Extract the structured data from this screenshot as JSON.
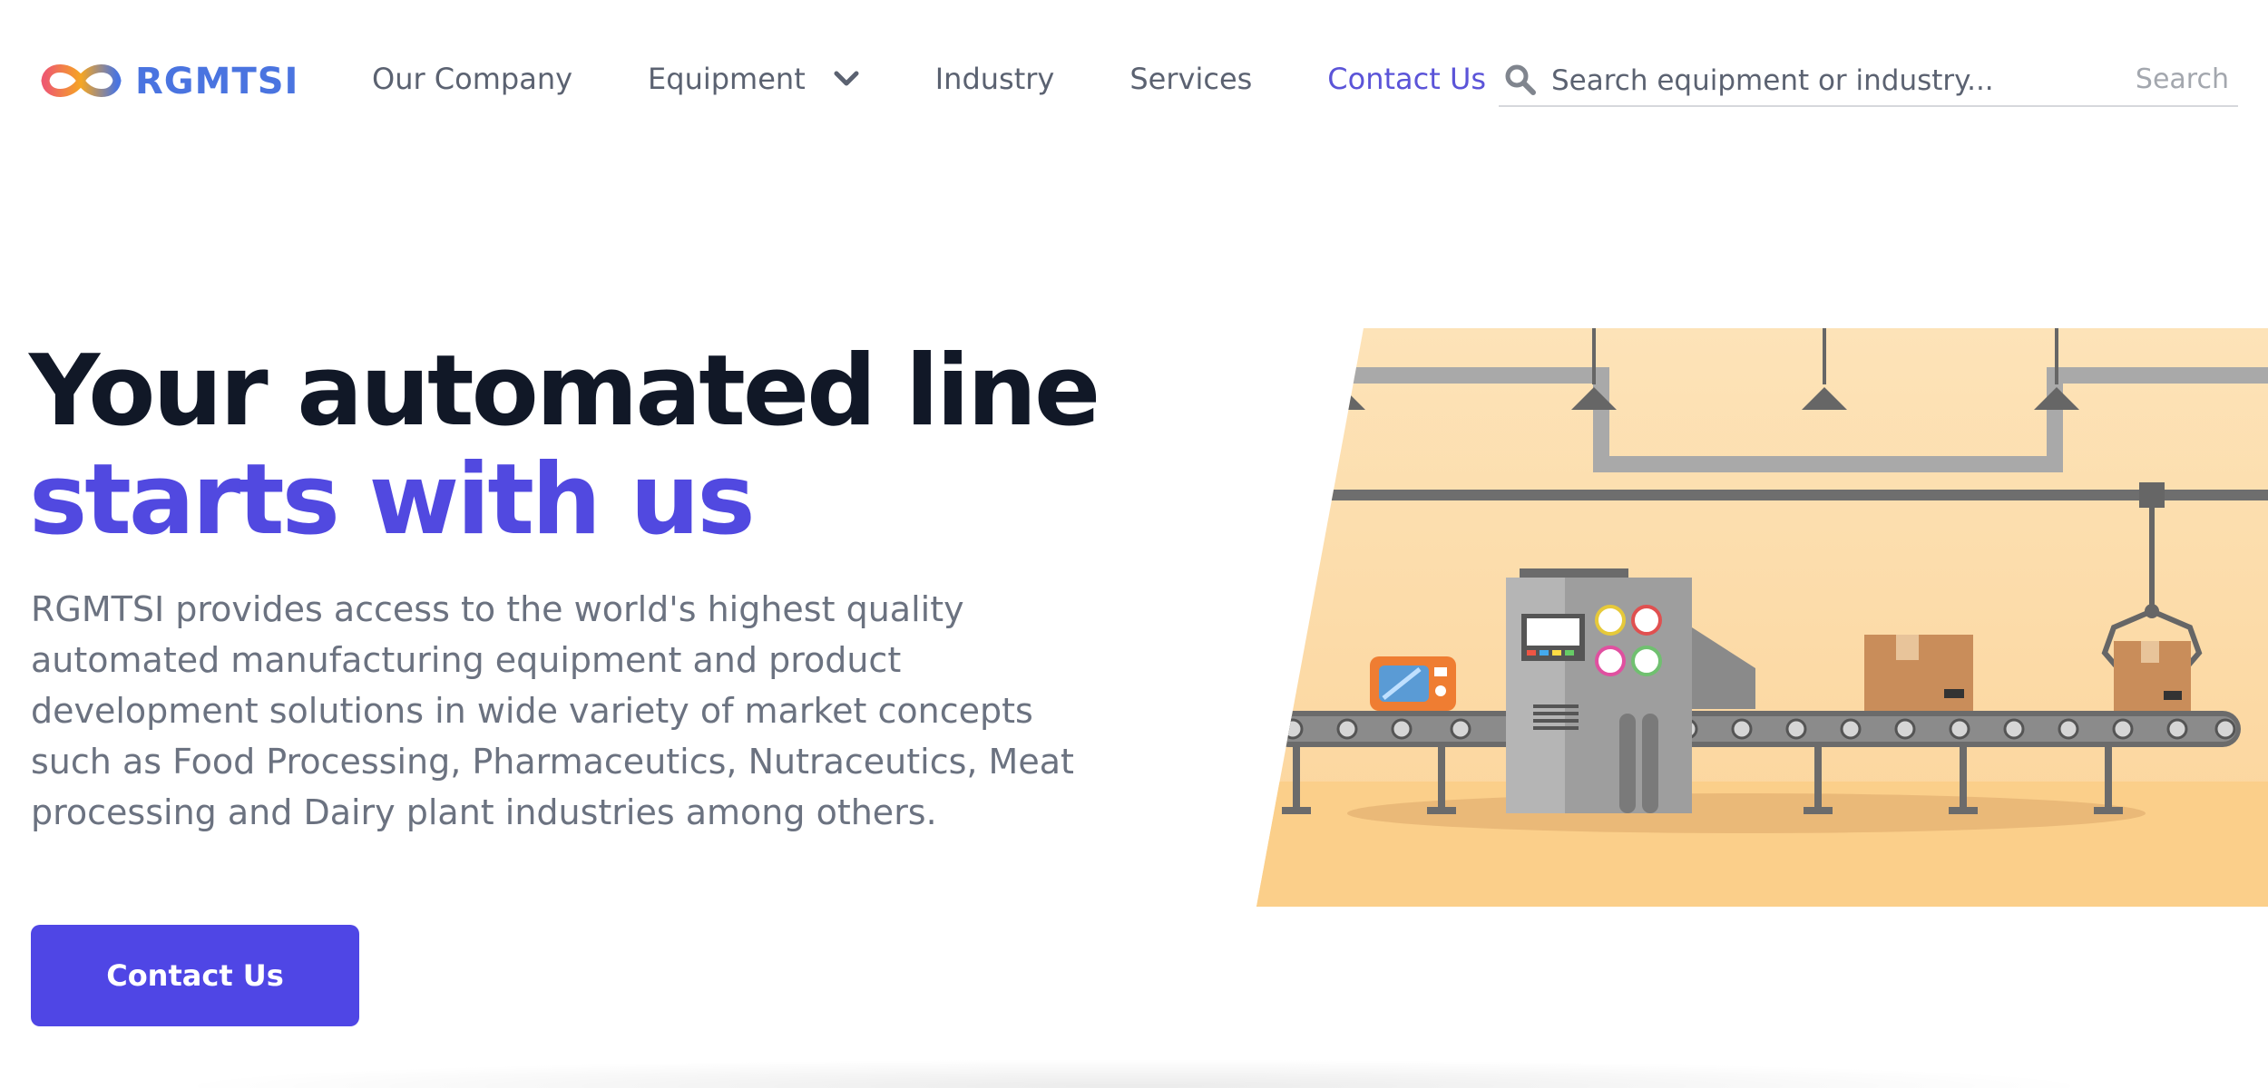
{
  "brand": {
    "name": "RGMTSI",
    "logo_icon": "infinity-logo-icon",
    "colors": {
      "brand_blue": "#4a74e0",
      "accent_red": "#ee5566",
      "accent_orange": "#f5a623"
    }
  },
  "nav": {
    "items": [
      {
        "label": "Our Company"
      },
      {
        "label": "Equipment",
        "icon": "chevron-down-icon"
      },
      {
        "label": "Industry"
      },
      {
        "label": "Services"
      },
      {
        "label": "Contact Us",
        "active": true
      }
    ],
    "active_color": "#5b54d8"
  },
  "search": {
    "placeholder": "Search equipment or industry...",
    "button_label": "Search",
    "icon": "search-icon"
  },
  "hero": {
    "title_line1": "Your automated line",
    "title_line2": "starts with us",
    "description": "RGMTSI provides access to the world's highest quality automated manufacturing equipment and product development solutions in wide variety of market concepts such as Food Processing, Pharmaceutics, Nutraceutics, Meat processing and Dairy plant industries among others.",
    "cta_label": "Contact Us",
    "accent_color": "#4f46e5"
  },
  "illustration": {
    "subject": "factory-conveyor-illustration",
    "background_color": "#fde0b0"
  }
}
